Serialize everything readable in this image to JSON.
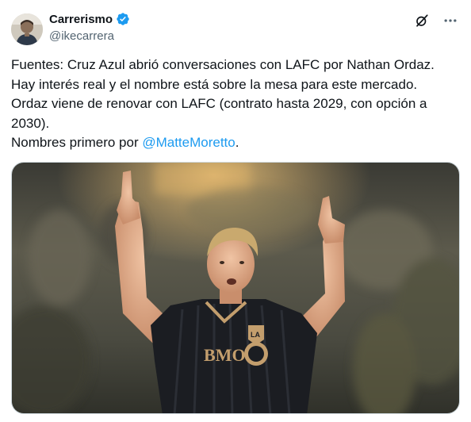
{
  "author": {
    "display_name": "Carrerismo",
    "handle": "@ikecarrera",
    "verified": true
  },
  "icons": {
    "avatar": "avatar-image",
    "verified": "verified-badge-icon",
    "grok": "grok-icon",
    "more": "more-options-icon"
  },
  "tweet": {
    "lines": [
      "Fuentes: Cruz Azul abrió conversaciones con LAFC por Nathan Ordaz.",
      "Hay interés real y el nombre está sobre la mesa para este mercado.",
      "Ordaz viene de renovar con LAFC (contrato hasta 2029, con opción a",
      "2030)."
    ],
    "last_line_prefix": "Nombres primero por ",
    "mention": "@MatteMoretto",
    "last_line_suffix": "."
  },
  "media": {
    "jersey_sponsor": "BMO",
    "jersey_badge": "LA"
  },
  "colors": {
    "link": "#1d9bf0",
    "verified": "#1d9bf0",
    "secondary_text": "#536471",
    "jersey": "#1b1d22",
    "jersey_accent": "#c39e6d"
  }
}
